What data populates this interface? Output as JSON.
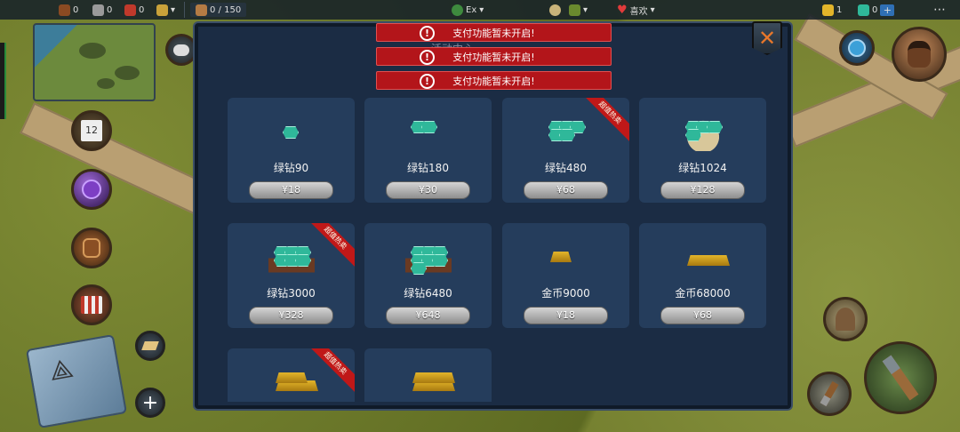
{
  "topbar": {
    "wood": "0",
    "stone": "0",
    "meat": "0",
    "population": "0 / 150",
    "faction": "Ex",
    "favorite": "喜欢",
    "gold": "1",
    "gems": "0",
    "plus": "+"
  },
  "side": {
    "calendar_day": "12",
    "plus": "+"
  },
  "alerts": [
    "支付功能暂未开启!",
    "支付功能暂未开启!",
    "支付功能暂未开启!"
  ],
  "alert_icon": "!",
  "panel": {
    "title_partial": "活动中心"
  },
  "products": [
    {
      "name": "绿钻90",
      "price": "¥18",
      "hot": false,
      "icon": "gem-small-icon"
    },
    {
      "name": "绿钻180",
      "price": "¥30",
      "hot": false,
      "icon": "gem-pile-icon"
    },
    {
      "name": "绿钻480",
      "price": "¥68",
      "hot": true,
      "icon": "gem-heap-icon"
    },
    {
      "name": "绿钻1024",
      "price": "¥128",
      "hot": false,
      "icon": "gem-sack-icon"
    },
    {
      "name": "绿钻3000",
      "price": "¥328",
      "hot": true,
      "icon": "gem-cart-icon"
    },
    {
      "name": "绿钻6480",
      "price": "¥648",
      "hot": false,
      "icon": "gem-chest-icon"
    },
    {
      "name": "金币9000",
      "price": "¥18",
      "hot": false,
      "icon": "gold-bar-icon"
    },
    {
      "name": "金币68000",
      "price": "¥68",
      "hot": false,
      "icon": "gold-bars-icon"
    },
    {
      "name": "",
      "price": "",
      "hot": true,
      "icon": "gold-heap-icon"
    },
    {
      "name": "",
      "price": "",
      "hot": false,
      "icon": "gold-stack-icon"
    }
  ],
  "ribbon_text": "超值热卖",
  "colors": {
    "panel": "#1b2c44",
    "card": "#253d5c",
    "alert": "#b3151a",
    "ribbon": "#c01818",
    "gem": "#2fb89a",
    "gold": "#e3b52a"
  }
}
